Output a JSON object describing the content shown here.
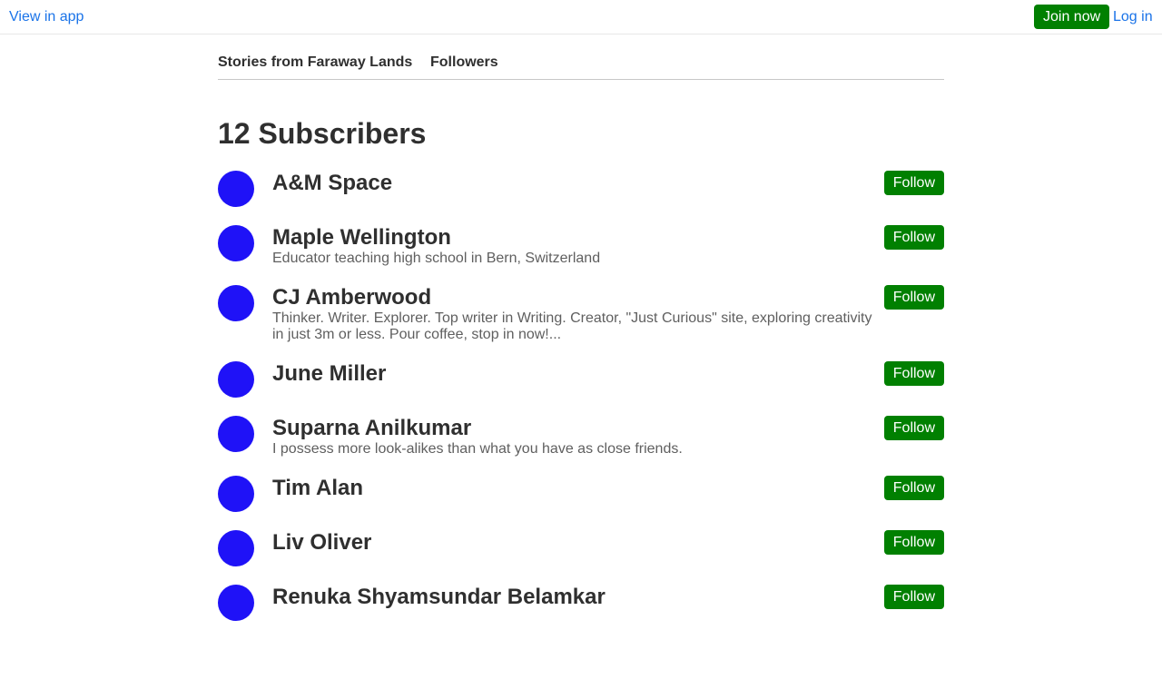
{
  "topbar": {
    "view_in_app": "View in app",
    "join_now": "Join now",
    "log_in": "Log in"
  },
  "tabs": [
    {
      "label": "Stories from Faraway Lands"
    },
    {
      "label": "Followers"
    }
  ],
  "page_title": "12 Subscribers",
  "follow_label": "Follow",
  "colors": {
    "accent_green": "#018001",
    "avatar_blue": "#1f12f7",
    "link_blue": "#1a73e8"
  },
  "subscribers": [
    {
      "name": "A&M Space",
      "bio": ""
    },
    {
      "name": "Maple Wellington",
      "bio": "Educator teaching high school in Bern, Switzerland"
    },
    {
      "name": "CJ Amberwood",
      "bio": "Thinker. Writer. Explorer. Top writer in Writing. Creator, \"Just Curious\" site, exploring creativity in just 3m or less. Pour coffee, stop in now!..."
    },
    {
      "name": "June Miller",
      "bio": ""
    },
    {
      "name": "Suparna Anilkumar",
      "bio": "I possess more look-alikes than what you have as close friends."
    },
    {
      "name": "Tim Alan",
      "bio": ""
    },
    {
      "name": "Liv Oliver",
      "bio": ""
    },
    {
      "name": "Renuka Shyamsundar Belamkar",
      "bio": ""
    }
  ]
}
